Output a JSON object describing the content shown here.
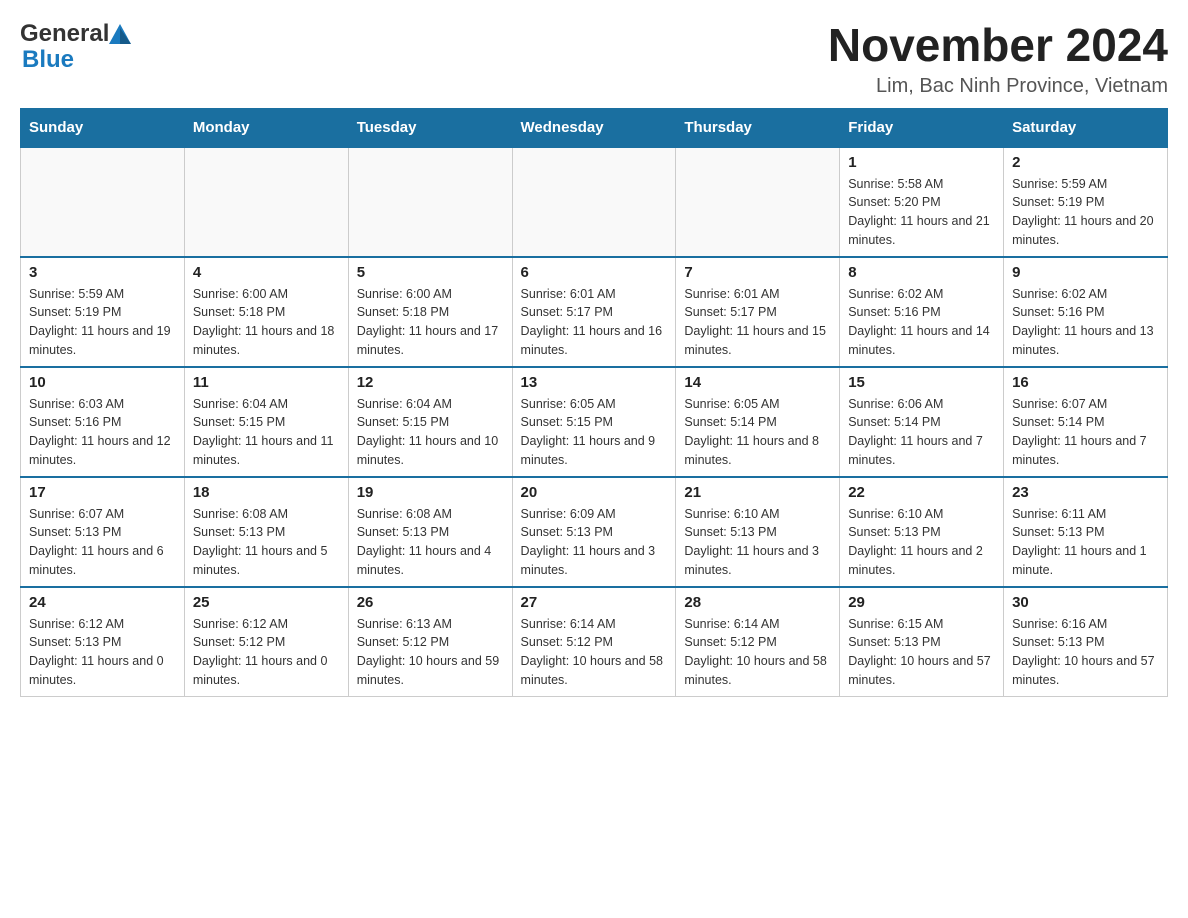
{
  "header": {
    "logo_general": "General",
    "logo_blue": "Blue",
    "month_title": "November 2024",
    "location": "Lim, Bac Ninh Province, Vietnam"
  },
  "days_of_week": [
    "Sunday",
    "Monday",
    "Tuesday",
    "Wednesday",
    "Thursday",
    "Friday",
    "Saturday"
  ],
  "weeks": [
    {
      "days": [
        {
          "num": "",
          "info": ""
        },
        {
          "num": "",
          "info": ""
        },
        {
          "num": "",
          "info": ""
        },
        {
          "num": "",
          "info": ""
        },
        {
          "num": "",
          "info": ""
        },
        {
          "num": "1",
          "info": "Sunrise: 5:58 AM\nSunset: 5:20 PM\nDaylight: 11 hours and 21 minutes."
        },
        {
          "num": "2",
          "info": "Sunrise: 5:59 AM\nSunset: 5:19 PM\nDaylight: 11 hours and 20 minutes."
        }
      ]
    },
    {
      "days": [
        {
          "num": "3",
          "info": "Sunrise: 5:59 AM\nSunset: 5:19 PM\nDaylight: 11 hours and 19 minutes."
        },
        {
          "num": "4",
          "info": "Sunrise: 6:00 AM\nSunset: 5:18 PM\nDaylight: 11 hours and 18 minutes."
        },
        {
          "num": "5",
          "info": "Sunrise: 6:00 AM\nSunset: 5:18 PM\nDaylight: 11 hours and 17 minutes."
        },
        {
          "num": "6",
          "info": "Sunrise: 6:01 AM\nSunset: 5:17 PM\nDaylight: 11 hours and 16 minutes."
        },
        {
          "num": "7",
          "info": "Sunrise: 6:01 AM\nSunset: 5:17 PM\nDaylight: 11 hours and 15 minutes."
        },
        {
          "num": "8",
          "info": "Sunrise: 6:02 AM\nSunset: 5:16 PM\nDaylight: 11 hours and 14 minutes."
        },
        {
          "num": "9",
          "info": "Sunrise: 6:02 AM\nSunset: 5:16 PM\nDaylight: 11 hours and 13 minutes."
        }
      ]
    },
    {
      "days": [
        {
          "num": "10",
          "info": "Sunrise: 6:03 AM\nSunset: 5:16 PM\nDaylight: 11 hours and 12 minutes."
        },
        {
          "num": "11",
          "info": "Sunrise: 6:04 AM\nSunset: 5:15 PM\nDaylight: 11 hours and 11 minutes."
        },
        {
          "num": "12",
          "info": "Sunrise: 6:04 AM\nSunset: 5:15 PM\nDaylight: 11 hours and 10 minutes."
        },
        {
          "num": "13",
          "info": "Sunrise: 6:05 AM\nSunset: 5:15 PM\nDaylight: 11 hours and 9 minutes."
        },
        {
          "num": "14",
          "info": "Sunrise: 6:05 AM\nSunset: 5:14 PM\nDaylight: 11 hours and 8 minutes."
        },
        {
          "num": "15",
          "info": "Sunrise: 6:06 AM\nSunset: 5:14 PM\nDaylight: 11 hours and 7 minutes."
        },
        {
          "num": "16",
          "info": "Sunrise: 6:07 AM\nSunset: 5:14 PM\nDaylight: 11 hours and 7 minutes."
        }
      ]
    },
    {
      "days": [
        {
          "num": "17",
          "info": "Sunrise: 6:07 AM\nSunset: 5:13 PM\nDaylight: 11 hours and 6 minutes."
        },
        {
          "num": "18",
          "info": "Sunrise: 6:08 AM\nSunset: 5:13 PM\nDaylight: 11 hours and 5 minutes."
        },
        {
          "num": "19",
          "info": "Sunrise: 6:08 AM\nSunset: 5:13 PM\nDaylight: 11 hours and 4 minutes."
        },
        {
          "num": "20",
          "info": "Sunrise: 6:09 AM\nSunset: 5:13 PM\nDaylight: 11 hours and 3 minutes."
        },
        {
          "num": "21",
          "info": "Sunrise: 6:10 AM\nSunset: 5:13 PM\nDaylight: 11 hours and 3 minutes."
        },
        {
          "num": "22",
          "info": "Sunrise: 6:10 AM\nSunset: 5:13 PM\nDaylight: 11 hours and 2 minutes."
        },
        {
          "num": "23",
          "info": "Sunrise: 6:11 AM\nSunset: 5:13 PM\nDaylight: 11 hours and 1 minute."
        }
      ]
    },
    {
      "days": [
        {
          "num": "24",
          "info": "Sunrise: 6:12 AM\nSunset: 5:13 PM\nDaylight: 11 hours and 0 minutes."
        },
        {
          "num": "25",
          "info": "Sunrise: 6:12 AM\nSunset: 5:12 PM\nDaylight: 11 hours and 0 minutes."
        },
        {
          "num": "26",
          "info": "Sunrise: 6:13 AM\nSunset: 5:12 PM\nDaylight: 10 hours and 59 minutes."
        },
        {
          "num": "27",
          "info": "Sunrise: 6:14 AM\nSunset: 5:12 PM\nDaylight: 10 hours and 58 minutes."
        },
        {
          "num": "28",
          "info": "Sunrise: 6:14 AM\nSunset: 5:12 PM\nDaylight: 10 hours and 58 minutes."
        },
        {
          "num": "29",
          "info": "Sunrise: 6:15 AM\nSunset: 5:13 PM\nDaylight: 10 hours and 57 minutes."
        },
        {
          "num": "30",
          "info": "Sunrise: 6:16 AM\nSunset: 5:13 PM\nDaylight: 10 hours and 57 minutes."
        }
      ]
    }
  ]
}
